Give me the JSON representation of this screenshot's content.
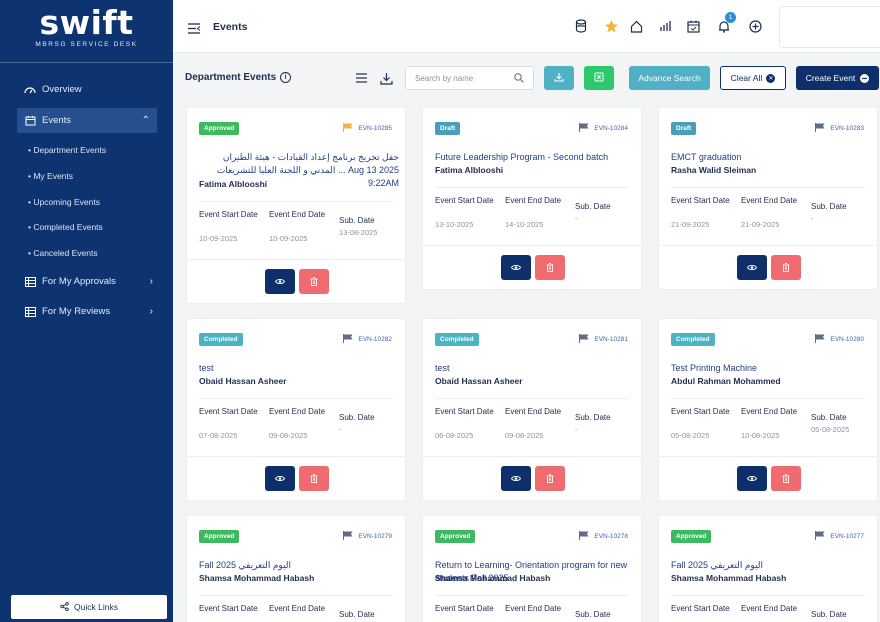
{
  "sidebar": {
    "logo": "swift",
    "logo_sub": "MBRSG SERVICE DESK",
    "items": [
      {
        "label": "Overview",
        "icon": "dashboard-icon"
      },
      {
        "label": "Events",
        "icon": "calendar-icon"
      },
      {
        "label": "For My Approvals",
        "icon": "list-icon"
      },
      {
        "label": "For My Reviews",
        "icon": "list-icon"
      }
    ],
    "sub_items": [
      {
        "label": "• Department Events"
      },
      {
        "label": "• My Events"
      },
      {
        "label": "• Upcoming Events"
      },
      {
        "label": "• Completed Events"
      },
      {
        "label": "• Canceled Events"
      }
    ],
    "quick_links": "Quick Links"
  },
  "header": {
    "title": "Events",
    "notification_count": "1"
  },
  "toolbar": {
    "section_title": "Department Events",
    "search_placeholder": "Search by name",
    "advance_search": "Advance Search",
    "clear_all": "Clear All",
    "create_event": "Create Event"
  },
  "labels": {
    "start": "Event Start Date",
    "end": "Event End Date",
    "sub": "Sub. Date"
  },
  "colors": {
    "sidebar": "#0d3470",
    "approved": "#3dba5f",
    "draft": "#4a9fb8",
    "completed": "#4ab3c4",
    "flag_yellow": "#f4b53f",
    "flag_gray": "#5f6d85"
  },
  "cards": [
    {
      "status": "Approved",
      "id": "EVN-10285",
      "title": "حفل تخريج برنامج إعداد القيادات - هيئة الطيران المدني و اللجنة العليا للتشريعات ... Aug 13 2025 9:22AM",
      "name": "Fatima Alblooshi",
      "start": "10-09-2025",
      "end": "10-09-2025",
      "sub": "13-08-2025"
    },
    {
      "status": "Draft",
      "id": "EVN-10284",
      "title": "Future Leadership Program - Second batch",
      "name": "Fatima Alblooshi",
      "start": "13-10-2025",
      "end": "14-10-2025",
      "sub": "-"
    },
    {
      "status": "Draft",
      "id": "EVN-10283",
      "title": "EMCT graduation",
      "name": "Rasha Walid Sleiman",
      "start": "21-09-2025",
      "end": "21-09-2025",
      "sub": "-"
    },
    {
      "status": "Completed",
      "id": "EVN-10282",
      "title": "test",
      "name": "Obaid Hassan Asheer",
      "start": "07-08-2025",
      "end": "09-08-2025",
      "sub": "-"
    },
    {
      "status": "Completed",
      "id": "EVN-10281",
      "title": "test",
      "name": "Obaid Hassan Asheer",
      "start": "06-08-2025",
      "end": "09-08-2025",
      "sub": "-"
    },
    {
      "status": "Completed",
      "id": "EVN-10280",
      "title": "Test Printing Machine",
      "name": "Abdul Rahman Mohammed",
      "start": "05-08-2025",
      "end": "10-08-2025",
      "sub": "05-08-2025"
    },
    {
      "status": "Approved",
      "id": "EVN-10279",
      "title": "Fall 2025 اليوم التعريفي",
      "name": "Shamsa Mohammad Habash",
      "start": "",
      "end": "",
      "sub": ""
    },
    {
      "status": "Approved",
      "id": "EVN-10278",
      "title": "Return to Learning- Orientation program for new students Fall 2025",
      "name": "Shamsa Mohammad Habash",
      "start": "",
      "end": "",
      "sub": ""
    },
    {
      "status": "Approved",
      "id": "EVN-10277",
      "title": "Fall 2025 اليوم التعريفي",
      "name": "Shamsa Mohammad Habash",
      "start": "",
      "end": "",
      "sub": ""
    }
  ]
}
